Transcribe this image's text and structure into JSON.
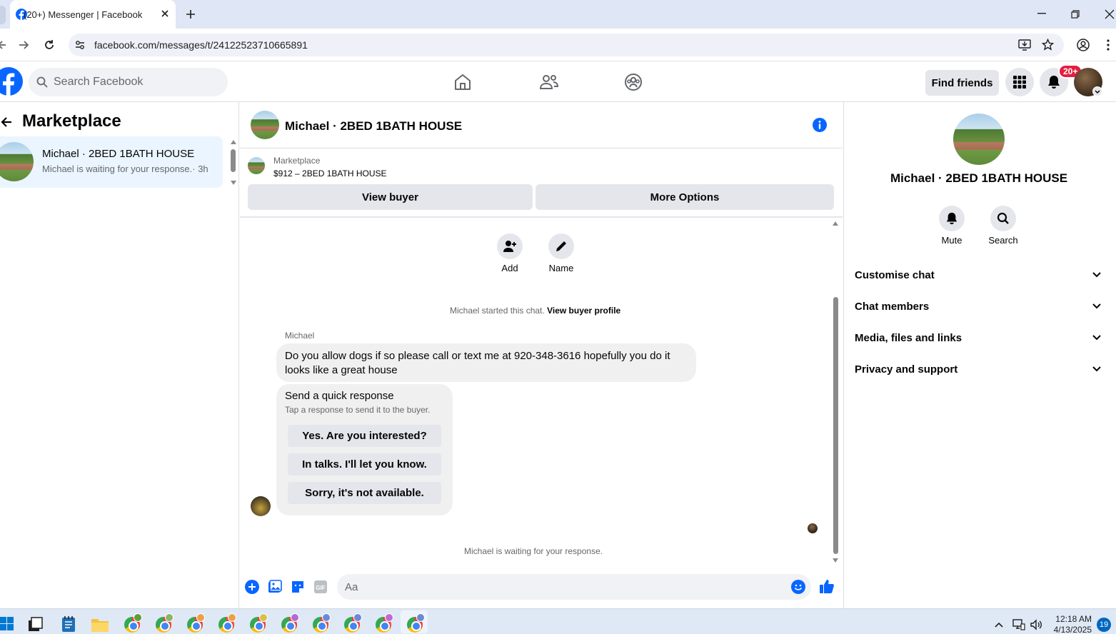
{
  "browser": {
    "tab_title": "(20+) Messenger | Facebook",
    "url": "facebook.com/messages/t/24122523710665891"
  },
  "fb_header": {
    "search_placeholder": "Search Facebook",
    "find_friends": "Find friends",
    "notif_badge": "20+"
  },
  "left_panel": {
    "title": "Marketplace",
    "conversation": {
      "name": "Michael · 2BED 1BATH HOUSE",
      "preview": "Michael is waiting for your response.· 3h"
    }
  },
  "chat": {
    "title": "Michael · 2BED 1BATH HOUSE",
    "marketplace_label": "Marketplace",
    "listing": "$912 – 2BED 1BATH HOUSE",
    "view_buyer": "View buyer",
    "more_options": "More Options",
    "actions": [
      {
        "label": "Add",
        "icon": "add-person-icon"
      },
      {
        "label": "Name",
        "icon": "pencil-icon"
      }
    ],
    "started_text": "Michael started this chat.",
    "view_profile": "View buyer profile",
    "sender": "Michael",
    "message": "Do you allow dogs if so please call or text me at 920-348-3616 hopefully you do it looks like a great house",
    "quick_response": {
      "title": "Send a quick response",
      "subtitle": "Tap a response to send it to the buyer.",
      "options": [
        "Yes. Are you interested?",
        "In talks. I'll let you know.",
        "Sorry, it's not available."
      ]
    },
    "waiting_text": "Michael is waiting for your response.",
    "composer_placeholder": "Aa"
  },
  "right_panel": {
    "name": "Michael · 2BED 1BATH HOUSE",
    "actions": [
      {
        "label": "Mute",
        "icon": "bell-icon"
      },
      {
        "label": "Search",
        "icon": "search-icon"
      }
    ],
    "sections": [
      "Customise chat",
      "Chat members",
      "Media, files and links",
      "Privacy and support"
    ]
  },
  "taskbar": {
    "time": "12:18 AM",
    "date": "4/13/2025",
    "notif_count": "19"
  },
  "colors": {
    "fb_blue": "#0866ff",
    "badge_red": "#e41e3f",
    "selected_bg": "#ebf5ff"
  }
}
